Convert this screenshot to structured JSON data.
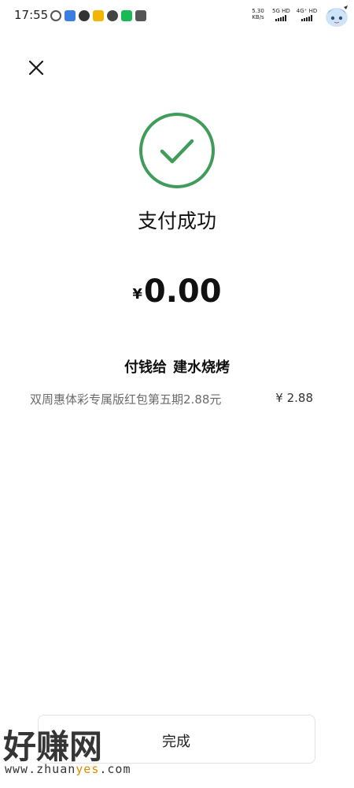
{
  "status_bar": {
    "time": "17:55",
    "net_speed_value": "5.30",
    "net_speed_unit": "KB/s",
    "sim1_label": "5G HD",
    "sim2_label": "4G⁺ HD",
    "icons": [
      "weibo-swirl-icon",
      "blue-app-icon",
      "chat-bubble-icon",
      "yellow-app-icon",
      "wechat-icon",
      "green-app-icon",
      "taobao-icon"
    ]
  },
  "close": {
    "icon": "close-icon"
  },
  "result": {
    "icon": "check-circle-icon",
    "title": "支付成功",
    "accent_color": "#3f9c5a"
  },
  "amount": {
    "currency": "¥",
    "value": "0.00"
  },
  "payee": {
    "prefix": "付钱给",
    "name": "建水烧烤"
  },
  "item": {
    "name": "双周惠体彩专属版红包第五期2.88元",
    "price": "¥ 2.88"
  },
  "done": {
    "label": "完成"
  },
  "watermark": {
    "main": "好赚网",
    "url_prefix": "www.zhuan",
    "url_highlight": "yes",
    "url_suffix": ".com",
    "highlight_color": "#e08a00"
  }
}
